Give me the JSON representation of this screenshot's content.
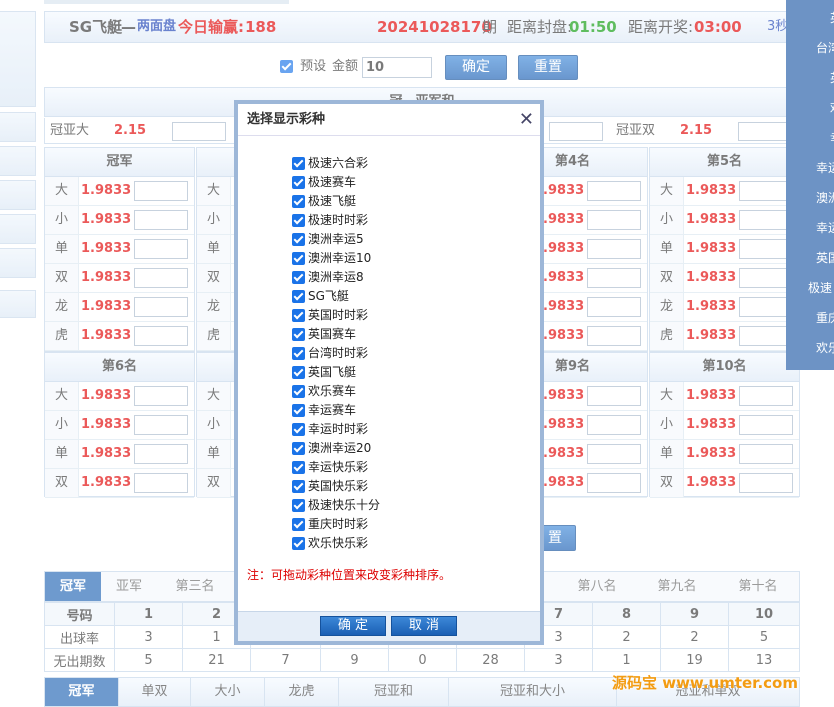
{
  "header": {
    "game_name": "SG飞艇",
    "dash": "—",
    "mode": "两面盘",
    "profit_label": "今日输赢:",
    "profit_value": "188",
    "issue_no": "20241028170",
    "issue_suffix": "期",
    "close_label": "距离封盘:",
    "close_time": "01:50",
    "draw_label": "距离开奖:",
    "draw_time": "03:00",
    "refresh": "3秒"
  },
  "controls": {
    "preset_label": "预设",
    "amount_label": "金额",
    "amount_value": "10",
    "confirm_label": "确定",
    "reset_label": "重置",
    "reset_label_bottom": "置"
  },
  "guanya": {
    "title": "冠、亚军和",
    "big_label": "冠亚大",
    "big_odds": "2.15",
    "double_label": "冠亚双",
    "double_odds": "2.15"
  },
  "positions_row1": [
    {
      "title": "冠军",
      "rows": [
        [
          "大",
          "1.9833"
        ],
        [
          "小",
          "1.9833"
        ],
        [
          "单",
          "1.9833"
        ],
        [
          "双",
          "1.9833"
        ],
        [
          "龙",
          "1.9833"
        ],
        [
          "虎",
          "1.9833"
        ]
      ]
    },
    {
      "title": "",
      "rows": [
        [
          "大",
          ""
        ],
        [
          "小",
          ""
        ],
        [
          "单",
          ""
        ],
        [
          "双",
          ""
        ],
        [
          "龙",
          ""
        ],
        [
          "虎",
          ""
        ]
      ]
    },
    {
      "title": "第4名",
      "rows": [
        [
          "",
          "1.9833"
        ],
        [
          "",
          "1.9833"
        ],
        [
          "",
          "1.9833"
        ],
        [
          "",
          "1.9833"
        ],
        [
          "",
          "1.9833"
        ],
        [
          "",
          "1.9833"
        ]
      ]
    },
    {
      "title": "第5名",
      "rows": [
        [
          "大",
          "1.9833"
        ],
        [
          "小",
          "1.9833"
        ],
        [
          "单",
          "1.9833"
        ],
        [
          "双",
          "1.9833"
        ],
        [
          "龙",
          "1.9833"
        ],
        [
          "虎",
          "1.9833"
        ]
      ]
    }
  ],
  "positions_row2": [
    {
      "title": "第6名",
      "rows": [
        [
          "大",
          "1.9833"
        ],
        [
          "小",
          "1.9833"
        ],
        [
          "单",
          "1.9833"
        ],
        [
          "双",
          "1.9833"
        ]
      ]
    },
    {
      "title": "",
      "rows": [
        [
          "大",
          ""
        ],
        [
          "小",
          ""
        ],
        [
          "单",
          ""
        ],
        [
          "双",
          ""
        ]
      ]
    },
    {
      "title": "第9名",
      "rows": [
        [
          "",
          "1.9833"
        ],
        [
          "",
          "1.9833"
        ],
        [
          "",
          "1.9833"
        ],
        [
          "",
          "1.9833"
        ]
      ]
    },
    {
      "title": "第10名",
      "rows": [
        [
          "大",
          "1.9833"
        ],
        [
          "小",
          "1.9833"
        ],
        [
          "单",
          "1.9833"
        ],
        [
          "双",
          "1.9833"
        ]
      ]
    }
  ],
  "right_menu": [
    "英",
    "台湾",
    "英",
    "欢",
    "幸",
    "幸运",
    "澳洲",
    "幸运",
    "英国",
    "极速",
    "重庆",
    "欢乐"
  ],
  "stats_tabs": [
    "冠军",
    "亚军",
    "第三名",
    "",
    "",
    "",
    "第八名",
    "第九名",
    "第十名"
  ],
  "stats": {
    "headers": [
      "号码",
      "1",
      "2",
      "",
      "",
      "",
      "",
      "7",
      "8",
      "9",
      "10"
    ],
    "rows": [
      [
        "出球率",
        "3",
        "1",
        "",
        "",
        "",
        "",
        "3",
        "2",
        "2",
        "5"
      ],
      [
        "无出期数",
        "5",
        "21",
        "7",
        "9",
        "0",
        "28",
        "3",
        "1",
        "19",
        "13"
      ]
    ]
  },
  "bottom_tabs": [
    "冠军",
    "单双",
    "大小",
    "龙虎",
    "冠亚和",
    "冠亚和大小",
    "冠亚和单双"
  ],
  "modal": {
    "title": "选择显示彩种",
    "items": [
      "极速六合彩",
      "极速赛车",
      "极速飞艇",
      "极速时时彩",
      "澳洲幸运5",
      "澳洲幸运10",
      "澳洲幸运8",
      "SG飞艇",
      "英国时时彩",
      "英国赛车",
      "台湾时时彩",
      "英国飞艇",
      "欢乐赛车",
      "幸运赛车",
      "幸运时时彩",
      "澳洲幸运20",
      "幸运快乐彩",
      "英国快乐彩",
      "极速快乐十分",
      "重庆时时彩",
      "欢乐快乐彩"
    ],
    "note": "注：可拖动彩种位置来改变彩种排序。",
    "ok_label": "确 定",
    "cancel_label": "取 消"
  },
  "watermark": "源码宝  www.umter.com",
  "colors": {
    "accent": "#2164b4",
    "odds_red": "#e00000",
    "modal_border": "#9db7d8"
  }
}
